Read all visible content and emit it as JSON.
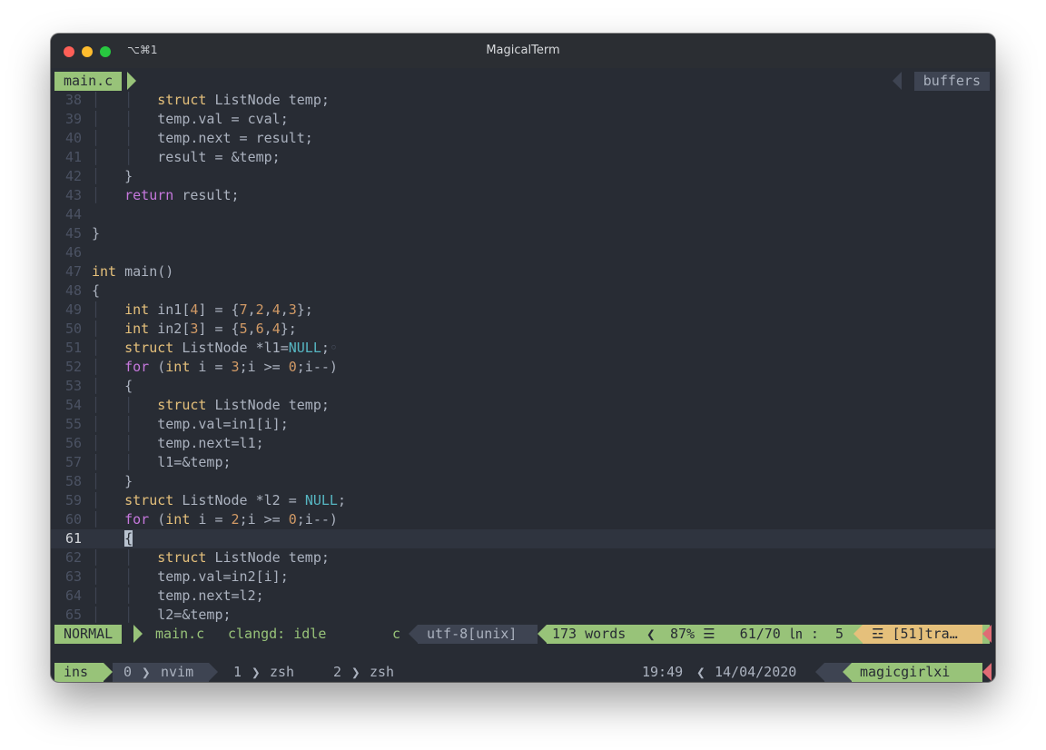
{
  "window": {
    "title": "MagicalTerm",
    "tab_shortcut": "⌥⌘1"
  },
  "tabline": {
    "current_file": "main.c",
    "buffers_label": "buffers"
  },
  "editor": {
    "cursor_line": 61,
    "lines": [
      {
        "num": "38",
        "indent": "│   │   ",
        "tokens": [
          {
            "c": "t",
            "v": "struct"
          },
          {
            "c": "",
            "v": " ListNode temp;"
          }
        ]
      },
      {
        "num": "39",
        "indent": "│   │   ",
        "tokens": [
          {
            "c": "",
            "v": "temp.val = cval;"
          }
        ]
      },
      {
        "num": "40",
        "indent": "│   │   ",
        "tokens": [
          {
            "c": "",
            "v": "temp.next = result;"
          }
        ]
      },
      {
        "num": "41",
        "indent": "│   │   ",
        "tokens": [
          {
            "c": "",
            "v": "result = &temp;"
          }
        ]
      },
      {
        "num": "42",
        "indent": "│   ",
        "tokens": [
          {
            "c": "",
            "v": "}"
          }
        ]
      },
      {
        "num": "43",
        "indent": "│   ",
        "tokens": [
          {
            "c": "k",
            "v": "return"
          },
          {
            "c": "",
            "v": " result;"
          }
        ]
      },
      {
        "num": "44",
        "indent": "",
        "tokens": []
      },
      {
        "num": "45",
        "indent": "",
        "tokens": [
          {
            "c": "",
            "v": "}"
          }
        ]
      },
      {
        "num": "46",
        "indent": "",
        "tokens": []
      },
      {
        "num": "47",
        "indent": "",
        "tokens": [
          {
            "c": "t",
            "v": "int"
          },
          {
            "c": "",
            "v": " main()"
          }
        ]
      },
      {
        "num": "48",
        "indent": "",
        "tokens": [
          {
            "c": "",
            "v": "{"
          }
        ]
      },
      {
        "num": "49",
        "indent": "│   ",
        "tokens": [
          {
            "c": "t",
            "v": "int"
          },
          {
            "c": "",
            "v": " in1["
          },
          {
            "c": "n",
            "v": "4"
          },
          {
            "c": "",
            "v": "] = {"
          },
          {
            "c": "n",
            "v": "7"
          },
          {
            "c": "",
            "v": ","
          },
          {
            "c": "n",
            "v": "2"
          },
          {
            "c": "",
            "v": ","
          },
          {
            "c": "n",
            "v": "4"
          },
          {
            "c": "",
            "v": ","
          },
          {
            "c": "n",
            "v": "3"
          },
          {
            "c": "",
            "v": "};"
          }
        ]
      },
      {
        "num": "50",
        "indent": "│   ",
        "tokens": [
          {
            "c": "t",
            "v": "int"
          },
          {
            "c": "",
            "v": " in2["
          },
          {
            "c": "n",
            "v": "3"
          },
          {
            "c": "",
            "v": "] = {"
          },
          {
            "c": "n",
            "v": "5"
          },
          {
            "c": "",
            "v": ","
          },
          {
            "c": "n",
            "v": "6"
          },
          {
            "c": "",
            "v": ","
          },
          {
            "c": "n",
            "v": "4"
          },
          {
            "c": "",
            "v": "};"
          }
        ]
      },
      {
        "num": "51",
        "indent": "│   ",
        "tokens": [
          {
            "c": "t",
            "v": "struct"
          },
          {
            "c": "",
            "v": " ListNode *l1="
          },
          {
            "c": "c",
            "v": "NULL"
          },
          {
            "c": "",
            "v": ";"
          },
          {
            "c": "ws",
            "v": "◦"
          }
        ]
      },
      {
        "num": "52",
        "indent": "│   ",
        "tokens": [
          {
            "c": "k",
            "v": "for"
          },
          {
            "c": "",
            "v": " ("
          },
          {
            "c": "t",
            "v": "int"
          },
          {
            "c": "",
            "v": " i = "
          },
          {
            "c": "n",
            "v": "3"
          },
          {
            "c": "",
            "v": ";i >= "
          },
          {
            "c": "n",
            "v": "0"
          },
          {
            "c": "",
            "v": ";i--)"
          }
        ]
      },
      {
        "num": "53",
        "indent": "│   ",
        "tokens": [
          {
            "c": "",
            "v": "{"
          }
        ]
      },
      {
        "num": "54",
        "indent": "│   │   ",
        "tokens": [
          {
            "c": "t",
            "v": "struct"
          },
          {
            "c": "",
            "v": " ListNode temp;"
          }
        ]
      },
      {
        "num": "55",
        "indent": "│   │   ",
        "tokens": [
          {
            "c": "",
            "v": "temp.val=in1[i];"
          }
        ]
      },
      {
        "num": "56",
        "indent": "│   │   ",
        "tokens": [
          {
            "c": "",
            "v": "temp.next=l1;"
          }
        ]
      },
      {
        "num": "57",
        "indent": "│   │   ",
        "tokens": [
          {
            "c": "",
            "v": "l1=&temp;"
          }
        ]
      },
      {
        "num": "58",
        "indent": "│   ",
        "tokens": [
          {
            "c": "",
            "v": "}"
          }
        ]
      },
      {
        "num": "59",
        "indent": "│   ",
        "tokens": [
          {
            "c": "t",
            "v": "struct"
          },
          {
            "c": "",
            "v": " ListNode *l2 = "
          },
          {
            "c": "c",
            "v": "NULL"
          },
          {
            "c": "",
            "v": ";"
          }
        ]
      },
      {
        "num": "60",
        "indent": "│   ",
        "tokens": [
          {
            "c": "k",
            "v": "for"
          },
          {
            "c": "",
            "v": " ("
          },
          {
            "c": "t",
            "v": "int"
          },
          {
            "c": "",
            "v": " i = "
          },
          {
            "c": "n",
            "v": "2"
          },
          {
            "c": "",
            "v": ";i >= "
          },
          {
            "c": "n",
            "v": "0"
          },
          {
            "c": "",
            "v": ";i--)"
          }
        ]
      },
      {
        "num": "61",
        "indent": "    ",
        "tokens": [
          {
            "c": "cursor",
            "v": "{"
          }
        ]
      },
      {
        "num": "62",
        "indent": "│   │   ",
        "tokens": [
          {
            "c": "t",
            "v": "struct"
          },
          {
            "c": "",
            "v": " ListNode temp;"
          }
        ]
      },
      {
        "num": "63",
        "indent": "│   │   ",
        "tokens": [
          {
            "c": "",
            "v": "temp.val=in2[i];"
          }
        ]
      },
      {
        "num": "64",
        "indent": "│   │   ",
        "tokens": [
          {
            "c": "",
            "v": "temp.next=l2;"
          }
        ]
      },
      {
        "num": "65",
        "indent": "│   │   ",
        "tokens": [
          {
            "c": "",
            "v": "l2=&temp;"
          }
        ]
      }
    ]
  },
  "statusline": {
    "mode": "NORMAL",
    "filename": "main.c",
    "lsp_status": "clangd: idle",
    "filetype": "c",
    "encoding": "utf-8[unix]",
    "word_count": "173 words",
    "position": "87% ☰   61/70 ㏑ :  5",
    "warnings": "☲ [51]tra…"
  },
  "tmux": {
    "session": "ins",
    "windows": [
      {
        "index": "0",
        "name": "nvim",
        "active": true
      },
      {
        "index": "1",
        "name": "zsh",
        "active": false
      },
      {
        "index": "2",
        "name": "zsh",
        "active": false
      }
    ],
    "time": "19:49",
    "date": "14/04/2020",
    "host": "magicgirlxi"
  },
  "colors": {
    "background": "#282c34",
    "accent_green": "#98c379",
    "accent_orange": "#e5c07b",
    "accent_red": "#e06c75",
    "panel_gray": "#3e4452"
  }
}
